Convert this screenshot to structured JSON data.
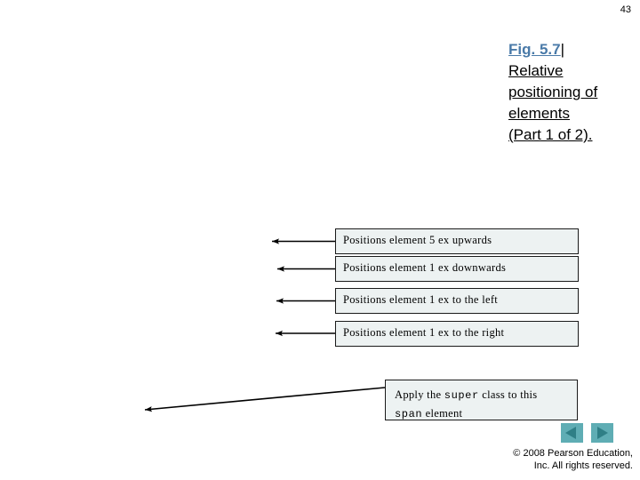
{
  "slide": {
    "page_number": "43",
    "background_color": "#ffffff"
  },
  "title": {
    "fig_label": "Fig. 5.7",
    "separator": "|",
    "rest": "Relative positioning of elements (Part 1 of 2).",
    "fig_color": "#4a7aa8",
    "rest_color": "#000000"
  },
  "callouts": [
    {
      "id": "callout-upwards",
      "text": "Positions element 5 ex upwards"
    },
    {
      "id": "callout-downwards",
      "text": "Positions element 1 ex downwards"
    },
    {
      "id": "callout-left",
      "text": "Positions element 1 ex to the left"
    },
    {
      "id": "callout-right",
      "text": "Positions element 1 ex to the right"
    }
  ],
  "callout_super": {
    "part1": "Apply the ",
    "code1": "super",
    "part2": " class to this",
    "code2": "span",
    "part3": " element"
  },
  "nav": {
    "prev_label": "Previous slide",
    "next_label": "Next slide",
    "button_color": "#5fadb4",
    "arrow_color": "#2f7f86"
  },
  "footer": {
    "line1": "© 2008 Pearson Education,",
    "line2": "Inc.  All rights reserved."
  }
}
